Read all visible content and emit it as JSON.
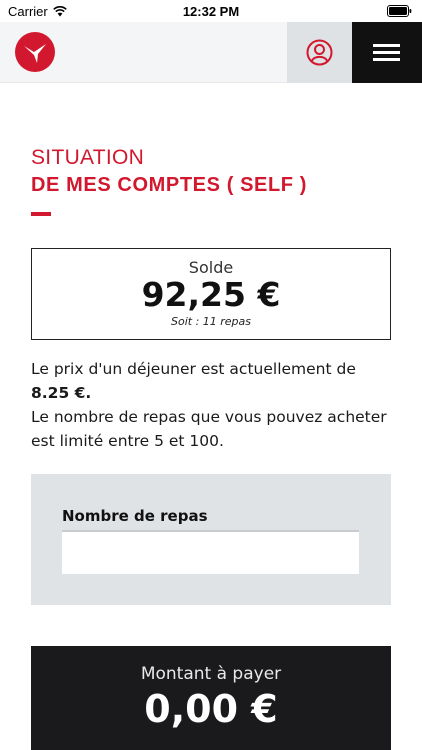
{
  "status_bar": {
    "carrier": "Carrier",
    "time": "12:32 PM"
  },
  "header": {
    "logo_icon": "bird-logo-icon",
    "user_icon": "user-account-icon",
    "menu_icon": "hamburger-menu-icon"
  },
  "page": {
    "title_line1": "SITUATION",
    "title_line2": "DE MES COMPTES ( SELF )"
  },
  "balance": {
    "label": "Solde",
    "amount": "92,25 €",
    "meals": "Soit : 11 repas"
  },
  "info": {
    "price_prefix": "Le prix d'un déjeuner est actuellement de ",
    "price_value": "8.25 €.",
    "limit_text": "Le nombre de repas que vous pouvez acheter est limité entre 5 et 100."
  },
  "form": {
    "label": "Nombre de repas",
    "value": ""
  },
  "payment": {
    "label": "Montant à payer",
    "amount": "0,00 €"
  },
  "colors": {
    "accent": "#d2182f",
    "dark": "#1a1a1d",
    "panel": "#dfe3e6"
  }
}
